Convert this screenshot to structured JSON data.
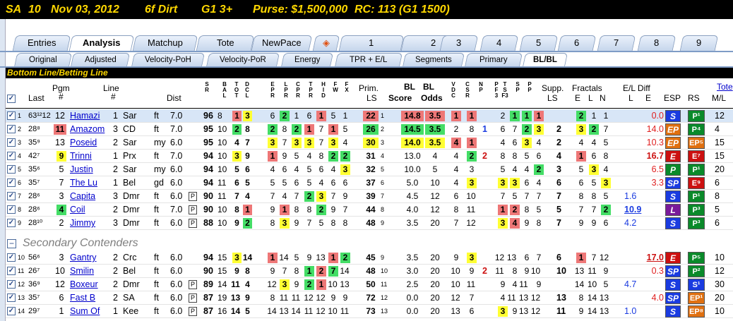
{
  "title": {
    "track": "SA",
    "race": "10",
    "date": "Nov 03, 2012",
    "dist_surface": "6f  Dirt",
    "grade": "G1  3+",
    "purse": "Purse: $1,500,000",
    "rc": "RC: 113  (G1 1500)"
  },
  "tabs_main": [
    "Entries",
    "Analysis",
    "Matchup",
    "Tote",
    "NewPace",
    "",
    "1",
    "2",
    "3",
    "4",
    "5",
    "6",
    "7",
    "8",
    "9"
  ],
  "tabs_sub": [
    "Original",
    "Adjusted",
    "Velocity-PoH",
    "Velocity-PoR",
    "Energy",
    "TPR + E/L",
    "Segments",
    "Primary",
    "BL/BL"
  ],
  "banner": "Bottom Line/Betting Line",
  "headers": {
    "last": "Last",
    "pgm": "Pgm",
    "pgm2": "#",
    "line": "Line",
    "line2": "#",
    "dist": "Dist",
    "prim": "Prim.",
    "ls": "LS",
    "bl1": "BL",
    "bl2": "BL",
    "score": "Score",
    "odds": "Odds",
    "supp": "Supp.",
    "supp2": "LS",
    "fractals": "Fractals",
    "e": "E",
    "l": "L",
    "n": "N",
    "eldiff": "E/L Diff",
    "eld_l": "L",
    "eld_e": "E",
    "esp": "ESP",
    "rs": "RS",
    "tote": "Tote",
    "ml": "M/L"
  },
  "section2": "Secondary Contenders",
  "rows": [
    {
      "n": "1",
      "last": "63¹²12",
      "pgm": "12",
      "name": "Hamazi",
      "line": "1",
      "trk": "Sar",
      "sf": "ft",
      "dist": "7.0",
      "p": false,
      "sr": "96",
      "bal": "8",
      "c1": "1",
      "c1c": "red",
      "c2": "3",
      "c2c": "yel",
      "ep": [
        "6",
        "2",
        "1",
        "6",
        "1",
        "5",
        "1"
      ],
      "epc": [
        "",
        "grn",
        "",
        "",
        "red",
        "",
        ""
      ],
      "prim": "22",
      "primc": "red",
      "primls": "1",
      "bls": "14.8",
      "blo": "3.5",
      "blc": "red",
      "v": "1",
      "vc": "red",
      "cs": "1",
      "csc": "red",
      "np": "",
      "p1": "2",
      "p2": "1",
      "p3": "1",
      "p4": "1",
      "pc": [
        "",
        "grn",
        "grn",
        "red"
      ],
      "supp": "",
      "fe": "2",
      "fl": "1",
      "fn": "1",
      "fc": [
        "grn",
        "",
        ""
      ],
      "ell": "",
      "ele": "0.0",
      "elec": "#e02020",
      "esp": "S",
      "espc": "#1a3be0",
      "rs": "P¹",
      "rsc": "#0a8a2a",
      "ml": "12"
    },
    {
      "n": "2",
      "last": "28⁸",
      "pgm": "11",
      "pgmc": "red",
      "name": "Amazom",
      "line": "3",
      "trk": "CD",
      "sf": "ft",
      "dist": "7.0",
      "p": false,
      "sr": "95",
      "bal": "10",
      "c1": "2",
      "c1c": "grn",
      "c2": "8",
      "c2c": "",
      "ep": [
        "2",
        "8",
        "2",
        "1",
        "7",
        "1",
        "5"
      ],
      "epc": [
        "grn",
        "",
        "grn",
        "red",
        "",
        "red",
        ""
      ],
      "prim": "26",
      "primc": "grn",
      "primls": "2",
      "bls": "14.5",
      "blo": "3.5",
      "blc": "grn",
      "v": "2",
      "vc": "",
      "cs": "8",
      "csc": "",
      "np": "1",
      "p1": "6",
      "p2": "7",
      "p3": "2",
      "p4": "3",
      "pc": [
        "",
        "",
        "grn",
        "yel"
      ],
      "supp": "2",
      "fe": "3",
      "fl": "2",
      "fn": "7",
      "fc": [
        "yel",
        "grn",
        ""
      ],
      "ell": "",
      "ele": "14.0",
      "elec": "#e02020",
      "esp": "EP",
      "espc": "#e07010",
      "rs": "P⁴",
      "rsc": "#0a8a2a",
      "ml": "4"
    },
    {
      "n": "3",
      "last": "35⁹",
      "pgm": "13",
      "name": "Poseid",
      "line": "2",
      "trk": "Sar",
      "sf": "my",
      "dist": "6.0",
      "p": false,
      "sr": "95",
      "bal": "10",
      "c1": "4",
      "c1c": "",
      "c2": "7",
      "c2c": "",
      "ep": [
        "3",
        "7",
        "3",
        "3",
        "7",
        "3",
        "4"
      ],
      "epc": [
        "yel",
        "",
        "yel",
        "yel",
        "",
        "yel",
        ""
      ],
      "prim": "30",
      "primc": "yel",
      "primls": "3",
      "bls": "14.0",
      "blo": "3.5",
      "blc": "yel",
      "v": "4",
      "vc": "red",
      "cs": "1",
      "csc": "red",
      "np": "",
      "p1": "4",
      "p2": "6",
      "p3": "3",
      "p4": "4",
      "pc": [
        "",
        "",
        "yel",
        ""
      ],
      "supp": "2",
      "fe": "4",
      "fl": "4",
      "fn": "5",
      "fc": [
        "",
        "",
        ""
      ],
      "ell": "",
      "ele": "10.3",
      "elec": "#e02020",
      "esp": "EP",
      "espc": "#e07010",
      "rs": "EP⁵",
      "rsc": "#e07010",
      "ml": "15"
    },
    {
      "n": "4",
      "last": "42⁷",
      "pgm": "9",
      "pgmc": "yel",
      "name": "Trinni",
      "line": "1",
      "trk": "Prx",
      "sf": "ft",
      "dist": "7.0",
      "p": false,
      "sr": "94",
      "bal": "10",
      "c1": "3",
      "c1c": "yel",
      "c2": "9",
      "c2c": "",
      "ep": [
        "1",
        "9",
        "5",
        "4",
        "8",
        "2",
        "2"
      ],
      "epc": [
        "red",
        "",
        "",
        "",
        "",
        "grn",
        "grn"
      ],
      "prim": "31",
      "primc": "",
      "primls": "4",
      "bls": "13.0",
      "blo": "4",
      "blc": "",
      "v": "4",
      "vc": "",
      "cs": "2",
      "csc": "grn",
      "np": "2",
      "p1": "8",
      "p2": "8",
      "p3": "5",
      "p4": "6",
      "pc": [
        "",
        "",
        "",
        ""
      ],
      "supp": "4",
      "fe": "1",
      "fl": "6",
      "fn": "8",
      "fc": [
        "red",
        "",
        ""
      ],
      "ell": "",
      "ele": "16.7",
      "elec": "#cc1010",
      "esp": "E",
      "espc": "#cc1010",
      "rs": "E⁷",
      "rsc": "#cc1010",
      "ml": "15"
    },
    {
      "n": "5",
      "last": "35⁶",
      "pgm": "5",
      "name": "Justin",
      "line": "2",
      "trk": "Sar",
      "sf": "my",
      "dist": "6.0",
      "p": false,
      "sr": "94",
      "bal": "10",
      "c1": "5",
      "c1c": "",
      "c2": "6",
      "c2c": "",
      "ep": [
        "4",
        "6",
        "4",
        "5",
        "6",
        "4",
        "3"
      ],
      "epc": [
        "",
        "",
        "",
        "",
        "",
        "",
        "yel"
      ],
      "prim": "32",
      "primc": "",
      "primls": "5",
      "bls": "10.0",
      "blo": "5",
      "blc": "",
      "v": "4",
      "vc": "",
      "cs": "3",
      "csc": "",
      "np": "",
      "p1": "5",
      "p2": "4",
      "p3": "4",
      "p4": "2",
      "pc": [
        "",
        "",
        "",
        "grn"
      ],
      "supp": "3",
      "fe": "5",
      "fl": "3",
      "fn": "4",
      "fc": [
        "",
        "yel",
        ""
      ],
      "ell": "",
      "ele": "6.5",
      "elec": "#e02020",
      "esp": "P",
      "espc": "#0a8a2a",
      "rs": "P¹",
      "rsc": "#0a8a2a",
      "ml": "20"
    },
    {
      "n": "6",
      "last": "35⁷",
      "pgm": "7",
      "name": "The Lu",
      "line": "1",
      "trk": "Bel",
      "sf": "gd",
      "dist": "6.0",
      "p": false,
      "sr": "94",
      "bal": "11",
      "c1": "6",
      "c1c": "",
      "c2": "5",
      "c2c": "",
      "ep": [
        "5",
        "5",
        "6",
        "5",
        "4",
        "6",
        "6"
      ],
      "epc": [
        "",
        "",
        "",
        "",
        "",
        "",
        ""
      ],
      "prim": "37",
      "primc": "",
      "primls": "6",
      "bls": "5.0",
      "blo": "10",
      "blc": "",
      "v": "4",
      "vc": "",
      "cs": "3",
      "csc": "yel",
      "np": "",
      "p1": "3",
      "p2": "3",
      "p3": "6",
      "p4": "4",
      "pc": [
        "yel",
        "yel",
        "",
        ""
      ],
      "supp": "6",
      "fe": "6",
      "fl": "5",
      "fn": "3",
      "fc": [
        "",
        "",
        "yel"
      ],
      "ell": "",
      "ele": "3.3",
      "elec": "#e02020",
      "esp": "SP",
      "espc": "#1a3be0",
      "rs": "E⁹",
      "rsc": "#cc1010",
      "ml": "6"
    },
    {
      "n": "7",
      "last": "28⁶",
      "pgm": "3",
      "name": "Capita",
      "line": "3",
      "trk": "Dmr",
      "sf": "ft",
      "dist": "6.0",
      "p": true,
      "sr": "90",
      "bal": "11",
      "c1": "7",
      "c1c": "",
      "c2": "4",
      "c2c": "",
      "ep": [
        "7",
        "4",
        "7",
        "2",
        "3",
        "7",
        "9"
      ],
      "epc": [
        "",
        "",
        "",
        "grn",
        "yel",
        "",
        ""
      ],
      "prim": "39",
      "primc": "",
      "primls": "7",
      "bls": "4.5",
      "blo": "12",
      "blc": "",
      "v": "6",
      "vc": "",
      "cs": "10",
      "csc": "",
      "np": "",
      "p1": "7",
      "p2": "5",
      "p3": "7",
      "p4": "7",
      "pc": [
        "",
        "",
        "",
        ""
      ],
      "supp": "7",
      "fe": "8",
      "fl": "8",
      "fn": "5",
      "fc": [
        "",
        "",
        ""
      ],
      "ell": "1.6",
      "ele": "",
      "elec": "#1a3be0",
      "esp": "S",
      "espc": "#1a3be0",
      "rs": "P¹",
      "rsc": "#0a8a2a",
      "ml": "8"
    },
    {
      "n": "8",
      "last": "28⁶",
      "pgm": "4",
      "pgmc": "grn",
      "name": "Coil",
      "line": "2",
      "trk": "Dmr",
      "sf": "ft",
      "dist": "7.0",
      "p": true,
      "sr": "90",
      "bal": "10",
      "c1": "8",
      "c1c": "",
      "c2": "1",
      "c2c": "red",
      "ep": [
        "9",
        "1",
        "8",
        "8",
        "2",
        "9",
        "7"
      ],
      "epc": [
        "",
        "red",
        "",
        "",
        "grn",
        "",
        ""
      ],
      "prim": "44",
      "primc": "",
      "primls": "8",
      "bls": "4.0",
      "blo": "12",
      "blc": "",
      "v": "8",
      "vc": "",
      "cs": "11",
      "csc": "",
      "np": "",
      "p1": "1",
      "p2": "2",
      "p3": "8",
      "p4": "5",
      "pc": [
        "red",
        "red",
        "",
        ""
      ],
      "supp": "5",
      "fe": "7",
      "fl": "7",
      "fn": "2",
      "fc": [
        "",
        "",
        "grn"
      ],
      "ell": "10.9",
      "ele": "",
      "elec": "#1a3be0",
      "esp": "L",
      "espc": "#7a1a9a",
      "rs": "P³",
      "rsc": "#0a8a2a",
      "ml": "5"
    },
    {
      "n": "9",
      "last": "28¹⁰",
      "pgm": "2",
      "name": "Jimmy",
      "line": "3",
      "trk": "Dmr",
      "sf": "ft",
      "dist": "6.0",
      "p": true,
      "sr": "88",
      "bal": "10",
      "c1": "9",
      "c1c": "",
      "c2": "2",
      "c2c": "grn",
      "ep": [
        "8",
        "3",
        "9",
        "7",
        "5",
        "8",
        "8"
      ],
      "epc": [
        "",
        "yel",
        "",
        "",
        "",
        "",
        ""
      ],
      "prim": "48",
      "primc": "",
      "primls": "9",
      "bls": "3.5",
      "blo": "20",
      "blc": "",
      "v": "7",
      "vc": "",
      "cs": "12",
      "csc": "",
      "np": "",
      "p1": "3",
      "p2": "4",
      "p3": "9",
      "p4": "8",
      "pc": [
        "yel",
        "red",
        "",
        ""
      ],
      "supp": "7",
      "fe": "9",
      "fl": "9",
      "fn": "6",
      "fc": [
        "",
        "",
        ""
      ],
      "ell": "4.2",
      "ele": "",
      "elec": "#1a3be0",
      "esp": "S",
      "espc": "#1a3be0",
      "rs": "P³",
      "rsc": "#0a8a2a",
      "ml": "6"
    }
  ],
  "rows2": [
    {
      "n": "10",
      "last": "56⁶",
      "pgm": "3",
      "name": "Gantry",
      "line": "2",
      "trk": "Crc",
      "sf": "ft",
      "dist": "6.0",
      "p": false,
      "sr": "94",
      "bal": "15",
      "c1": "3",
      "c1c": "yel",
      "c2": "14",
      "c2c": "",
      "ep": [
        "1",
        "14",
        "5",
        "9",
        "13",
        "1",
        "2"
      ],
      "epc": [
        "red",
        "",
        "",
        "",
        "",
        "red",
        "grn"
      ],
      "prim": "45",
      "primc": "",
      "primls": "9",
      "bls": "3.5",
      "blo": "20",
      "blc": "",
      "v": "9",
      "vc": "",
      "cs": "3",
      "csc": "yel",
      "np": "",
      "p1": "12",
      "p2": "13",
      "p3": "6",
      "p4": "7",
      "pc": [
        "",
        "",
        "",
        ""
      ],
      "supp": "6",
      "fe": "1",
      "fl": "7",
      "fn": "12",
      "fc": [
        "red",
        "",
        ""
      ],
      "ell": "",
      "ele": "17.0",
      "elec": "#cc1010",
      "esp": "E",
      "espc": "#cc1010",
      "rs": "P⁵",
      "rsc": "#0a8a2a",
      "ml": "10"
    },
    {
      "n": "11",
      "last": "26⁷",
      "pgm": "10",
      "name": "Smilin",
      "line": "2",
      "trk": "Bel",
      "sf": "ft",
      "dist": "6.0",
      "p": false,
      "sr": "90",
      "bal": "15",
      "c1": "9",
      "c1c": "",
      "c2": "8",
      "c2c": "",
      "ep": [
        "9",
        "7",
        "8",
        "1",
        "2",
        "7",
        "14"
      ],
      "epc": [
        "",
        "",
        "",
        "grn",
        "red",
        "grn",
        ""
      ],
      "prim": "48",
      "primc": "",
      "primls": "10",
      "bls": "3.0",
      "blo": "20",
      "blc": "",
      "v": "10",
      "vc": "",
      "cs": "9",
      "csc": "",
      "np": "2",
      "p1": "11",
      "p2": "8",
      "p3": "9",
      "p4": "10",
      "pc": [
        "",
        "",
        "",
        ""
      ],
      "supp": "10",
      "fe": "13",
      "fl": "11",
      "fn": "9",
      "fc": [
        "",
        "",
        ""
      ],
      "ell": "",
      "ele": "0.3",
      "elec": "#e02020",
      "esp": "SP",
      "espc": "#1a3be0",
      "rs": "P²",
      "rsc": "#0a8a2a",
      "ml": "12"
    },
    {
      "n": "12",
      "last": "36⁹",
      "pgm": "12",
      "name": "Boxeur",
      "line": "2",
      "trk": "Dmr",
      "sf": "ft",
      "dist": "6.0",
      "p": true,
      "sr": "89",
      "bal": "14",
      "c1": "11",
      "c1c": "",
      "c2": "4",
      "c2c": "",
      "ep": [
        "12",
        "3",
        "9",
        "2",
        "1",
        "10",
        "13"
      ],
      "epc": [
        "",
        "yel",
        "",
        "grn",
        "red",
        "",
        ""
      ],
      "prim": "50",
      "primc": "",
      "primls": "11",
      "bls": "2.5",
      "blo": "20",
      "blc": "",
      "v": "10",
      "vc": "",
      "cs": "11",
      "csc": "",
      "np": "",
      "p1": "9",
      "p2": "4",
      "p3": "11",
      "p4": "9",
      "pc": [
        "",
        "",
        "",
        ""
      ],
      "supp": "",
      "fe": "14",
      "fl": "10",
      "fn": "5",
      "fc": [
        "",
        "",
        ""
      ],
      "ell": "4.7",
      "ele": "",
      "elec": "#1a3be0",
      "esp": "S",
      "espc": "#1a3be0",
      "rs": "S¹",
      "rsc": "#1a3be0",
      "ml": "30"
    },
    {
      "n": "13",
      "last": "35⁷",
      "pgm": "6",
      "name": "Fast B",
      "line": "2",
      "trk": "SA",
      "sf": "ft",
      "dist": "6.0",
      "p": true,
      "sr": "87",
      "bal": "19",
      "c1": "13",
      "c1c": "",
      "c2": "9",
      "c2c": "",
      "ep": [
        "8",
        "11",
        "11",
        "12",
        "12",
        "9",
        "9"
      ],
      "epc": [
        "",
        "",
        "",
        "",
        "",
        "",
        ""
      ],
      "prim": "72",
      "primc": "",
      "primls": "12",
      "bls": "0.0",
      "blo": "20",
      "blc": "",
      "v": "12",
      "vc": "",
      "cs": "7",
      "csc": "",
      "np": "",
      "p1": "4",
      "p2": "11",
      "p3": "13",
      "p4": "12",
      "pc": [
        "",
        "",
        "",
        ""
      ],
      "supp": "13",
      "fe": "8",
      "fl": "14",
      "fn": "13",
      "fc": [
        "",
        "",
        ""
      ],
      "ell": "",
      "ele": "4.0",
      "elec": "#e02020",
      "esp": "SP",
      "espc": "#1a3be0",
      "rs": "EP¹",
      "rsc": "#e07010",
      "ml": "20"
    },
    {
      "n": "14",
      "last": "29⁷",
      "pgm": "1",
      "name": "Sum Of",
      "line": "1",
      "trk": "Kee",
      "sf": "ft",
      "dist": "6.0",
      "p": true,
      "sr": "87",
      "bal": "16",
      "c1": "14",
      "c1c": "",
      "c2": "5",
      "c2c": "",
      "ep": [
        "14",
        "13",
        "14",
        "11",
        "12",
        "10",
        "11"
      ],
      "epc": [
        "",
        "",
        "",
        "",
        "",
        "",
        ""
      ],
      "prim": "73",
      "primc": "",
      "primls": "13",
      "bls": "0.0",
      "blo": "20",
      "blc": "",
      "v": "13",
      "vc": "",
      "cs": "6",
      "csc": "",
      "np": "",
      "p1": "3",
      "p2": "9",
      "p3": "13",
      "p4": "12",
      "pc": [
        "yel",
        "",
        "",
        ""
      ],
      "supp": "11",
      "fe": "9",
      "fl": "14",
      "fn": "13",
      "fc": [
        "",
        "",
        ""
      ],
      "ell": "1.0",
      "ele": "",
      "elec": "#1a3be0",
      "esp": "S",
      "espc": "#1a3be0",
      "rs": "EP⁸",
      "rsc": "#e07010",
      "ml": "10"
    }
  ]
}
